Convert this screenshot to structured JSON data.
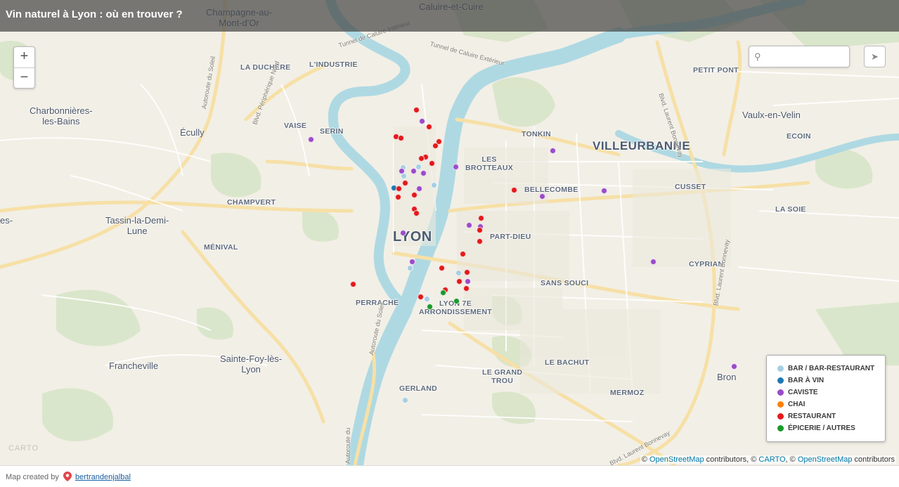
{
  "title": "Vin naturel à Lyon : où en trouver ?",
  "zoom": {
    "in_label": "+",
    "out_label": "−"
  },
  "search": {
    "placeholder": "",
    "value": ""
  },
  "places": [
    {
      "name": "Caluire-et-Cuire",
      "cls": "town"
    },
    {
      "name": "Champagne-au-\nMont-d'Or",
      "cls": "town"
    },
    {
      "name": "LA DUCHÈRE",
      "cls": ""
    },
    {
      "name": "L'INDUSTRIE",
      "cls": ""
    },
    {
      "name": "PETIT PONT",
      "cls": ""
    },
    {
      "name": "Charbonnières-\nles-Bains",
      "cls": "town"
    },
    {
      "name": "VAISE",
      "cls": ""
    },
    {
      "name": "SERIN",
      "cls": ""
    },
    {
      "name": "Écully",
      "cls": "town"
    },
    {
      "name": "TONKIN",
      "cls": ""
    },
    {
      "name": "Vaulx-en-Velin",
      "cls": "town"
    },
    {
      "name": "ECOIN",
      "cls": ""
    },
    {
      "name": "VILLEURBANNE",
      "cls": "big"
    },
    {
      "name": "LES\nBROTTEAUX",
      "cls": ""
    },
    {
      "name": "BELLECOMBE",
      "cls": ""
    },
    {
      "name": "CUSSET",
      "cls": ""
    },
    {
      "name": "CHAMPVERT",
      "cls": ""
    },
    {
      "name": "LA SOIE",
      "cls": ""
    },
    {
      "name": "Tassin-la-Demi-\nLune",
      "cls": "town"
    },
    {
      "name": "LYON",
      "cls": "huge"
    },
    {
      "name": "PART-DIEU",
      "cls": ""
    },
    {
      "name": "MÉNIVAL",
      "cls": ""
    },
    {
      "name": "CYPRIAN",
      "cls": ""
    },
    {
      "name": "SANS SOUCI",
      "cls": ""
    },
    {
      "name": "PERRACHE",
      "cls": ""
    },
    {
      "name": "LYON 7E\nARRONDISSEMENT",
      "cls": ""
    },
    {
      "name": "Sainte-Foy-lès-\nLyon",
      "cls": "town"
    },
    {
      "name": "Francheville",
      "cls": "town"
    },
    {
      "name": "LE BACHUT",
      "cls": ""
    },
    {
      "name": "LE GRAND\nTROU",
      "cls": ""
    },
    {
      "name": "MERMOZ",
      "cls": ""
    },
    {
      "name": "Bron",
      "cls": "town"
    },
    {
      "name": "GERLAND",
      "cls": ""
    },
    {
      "name": "es-",
      "cls": "town"
    }
  ],
  "roads": [
    "Tunnel de Caluire Intérieur",
    "Tunnel de Caluire Extérieur",
    "Autoroute du Soleil",
    "Blvd. Périphérique Nord",
    "Blvd. Laurent Bonnevay",
    "Blvd. Laurent Bonnevay",
    "Autoroute du Soleil",
    "Blvd. Laurent Bonnevay",
    "Autoroute du"
  ],
  "legend": [
    {
      "label": "BAR / BAR-RESTAURANT",
      "color": "#a6cee3"
    },
    {
      "label": "BAR À VIN",
      "color": "#1f78b4"
    },
    {
      "label": "CAVISTE",
      "color": "#9c4bc9"
    },
    {
      "label": "CHAI",
      "color": "#ff7f00"
    },
    {
      "label": "RESTAURANT",
      "color": "#e31a1c"
    },
    {
      "label": "ÉPICERIE / AUTRES",
      "color": "#1a9a2a"
    }
  ],
  "marker_categories": [
    "RESTAURANT",
    "CAVISTE",
    "BAR / BAR-RESTAURANT",
    "BAR À VIN",
    "ÉPICERIE / AUTRES"
  ],
  "attribution": {
    "sep1": "© ",
    "osm": "OpenStreetMap",
    "mid1": " contributors, © ",
    "carto": "CARTO",
    "mid2": ", © ",
    "osm2": "OpenStreetMap",
    "end": " contributors"
  },
  "footer": {
    "created_by": "Map created by",
    "author": "bertrandenjalbal"
  },
  "carto_watermark": "CARTO"
}
